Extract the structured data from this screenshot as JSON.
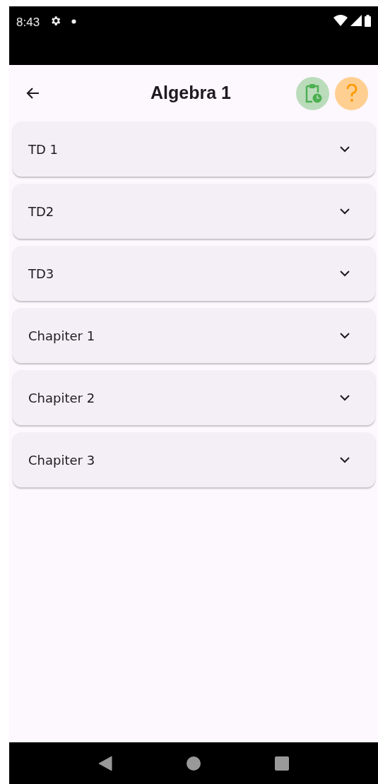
{
  "status_bar": {
    "time": "8:43"
  },
  "app_bar": {
    "title": "Algebra 1"
  },
  "sections": [
    {
      "title": "TD 1",
      "expanded": false
    },
    {
      "title": "TD2",
      "expanded": false
    },
    {
      "title": "TD3",
      "expanded": false
    },
    {
      "title": "Chapiter 1",
      "expanded": false
    },
    {
      "title": "Chapiter 2",
      "expanded": false
    },
    {
      "title": "Chapiter 3",
      "expanded": false
    }
  ]
}
